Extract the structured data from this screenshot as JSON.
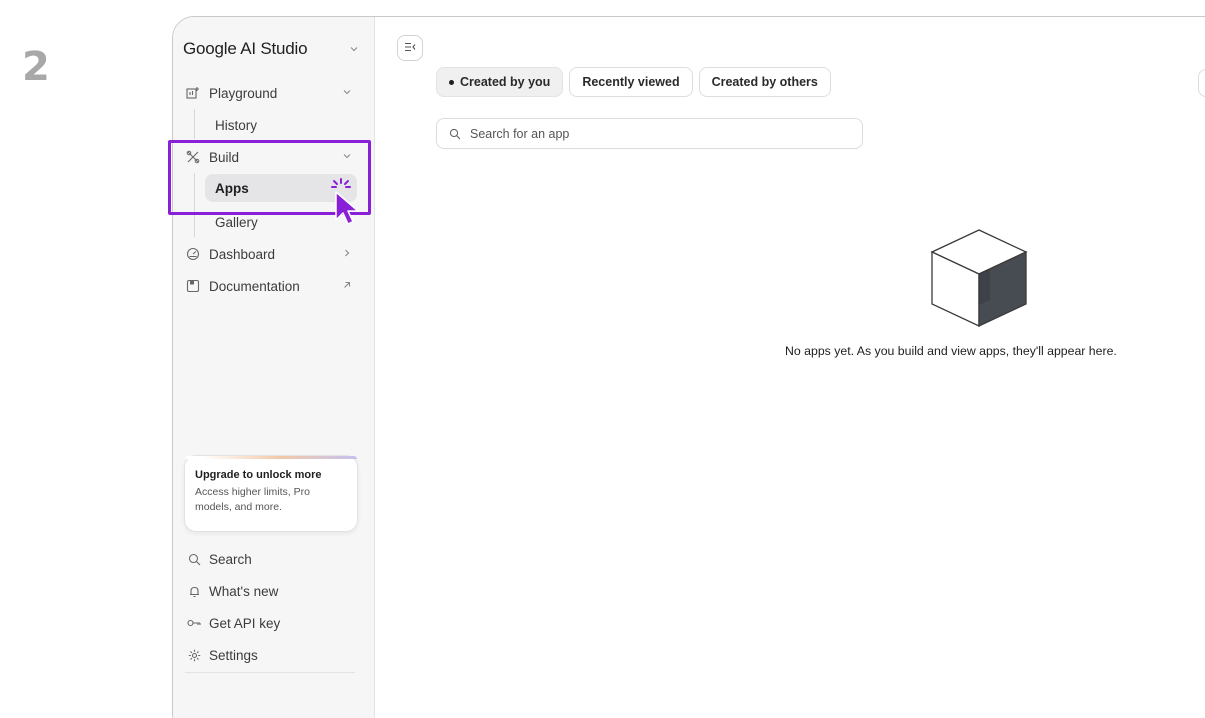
{
  "step_label": "2",
  "sidebar": {
    "brand": "Google AI Studio",
    "items": [
      {
        "label": "Playground",
        "icon": "playground-icon",
        "right": "chevron-down"
      },
      {
        "label": "History"
      },
      {
        "label": "Build",
        "icon": "build-icon",
        "right": "chevron-down"
      },
      {
        "label": "Apps",
        "active": true
      },
      {
        "label": "Gallery"
      },
      {
        "label": "Dashboard",
        "icon": "dashboard-icon",
        "right": "chevron-right"
      },
      {
        "label": "Documentation",
        "icon": "documentation-icon",
        "right": "external-link"
      }
    ],
    "upgrade": {
      "title": "Upgrade to unlock more",
      "description": "Access higher limits, Pro models, and more."
    },
    "bottom": [
      {
        "label": "Search",
        "icon": "search-icon"
      },
      {
        "label": "What's new",
        "icon": "bell-icon"
      },
      {
        "label": "Get API key",
        "icon": "key-icon"
      },
      {
        "label": "Settings",
        "icon": "gear-icon"
      }
    ]
  },
  "main": {
    "tabs": [
      {
        "label": "Created by you",
        "active": true
      },
      {
        "label": "Recently viewed"
      },
      {
        "label": "Created by others"
      }
    ],
    "search": {
      "placeholder": "Search for an app",
      "value": ""
    },
    "empty_state": "No apps yet. As you build and view apps, they'll appear here."
  },
  "colors": {
    "highlight": "#8a1fd8",
    "cursor": "#8a1fd8",
    "sidebar_bg": "#f6f6f7",
    "active_item_bg": "#e5e5e8"
  }
}
